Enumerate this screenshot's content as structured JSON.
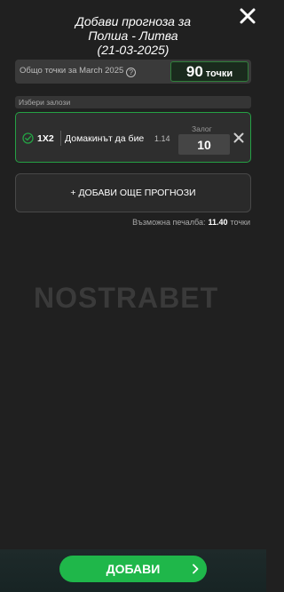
{
  "header": {
    "title_line1": "Добави прогноза за",
    "title_line2": "Полша - Литва",
    "title_line3": "(21-03-2025)",
    "close_icon": "close-icon"
  },
  "points": {
    "label": "Общо точки за March 2025",
    "help_icon": "help-icon",
    "help_glyph": "?",
    "value": "90",
    "unit": "точки"
  },
  "picks_section": {
    "label": "Избери залози"
  },
  "bet": {
    "market": "1X2",
    "selection": "Домакинът да бие",
    "odds": "1.14",
    "stake_label": "Залог",
    "stake_value": "10",
    "selected": true
  },
  "add_more": {
    "label": "+ ДОБАВИ ОЩЕ ПРОГНОЗИ"
  },
  "possible_win": {
    "label": "Възможна печалба:",
    "amount": "11.40",
    "unit": "точки"
  },
  "watermark": {
    "text": "NOSTRABET"
  },
  "footer": {
    "button_label": "ДОБАВИ"
  },
  "colors": {
    "background": "#202020",
    "accent_green": "#1fb74a",
    "selected_border": "#25a144"
  }
}
